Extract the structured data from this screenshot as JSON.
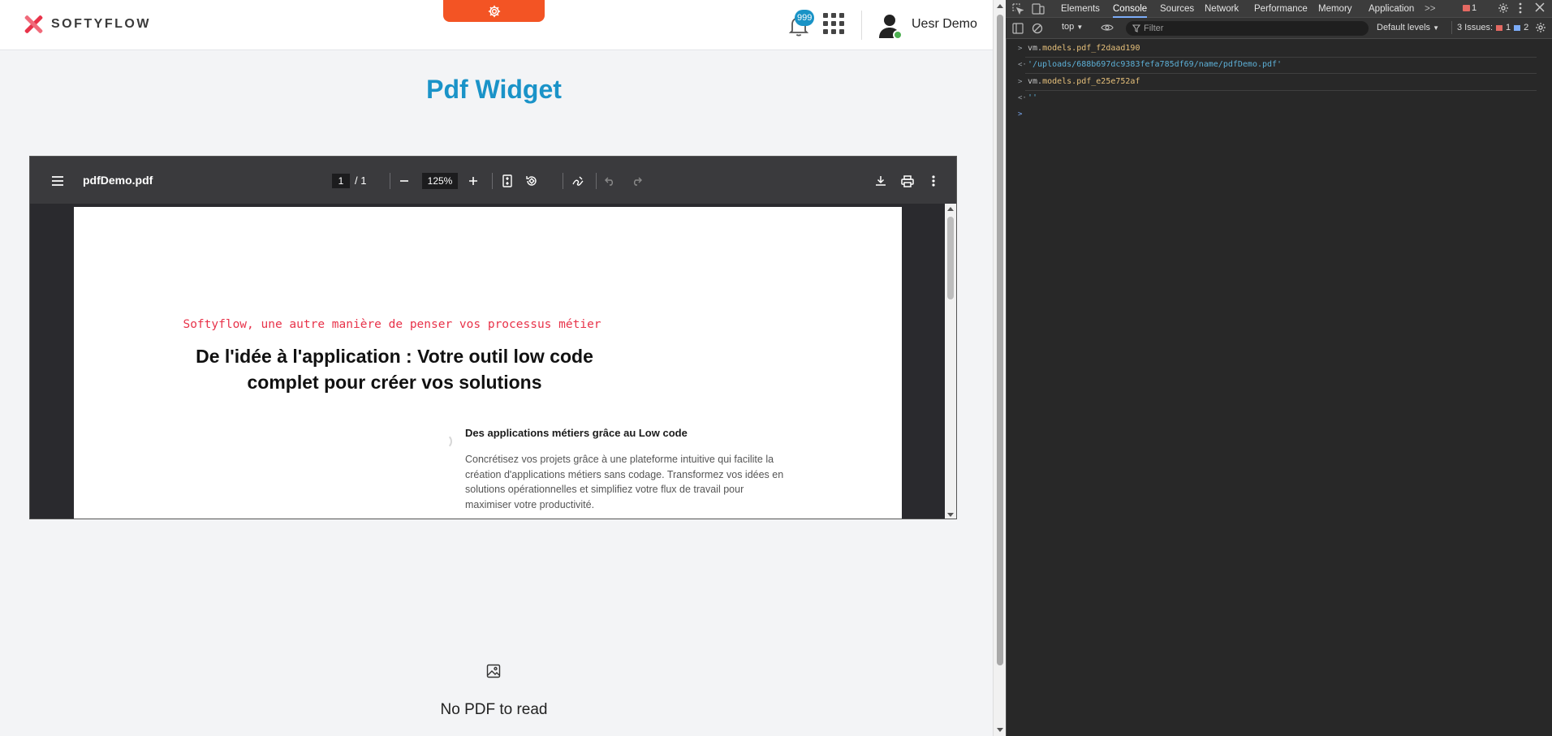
{
  "app": {
    "logo_text": "SOFTYFLOW",
    "notifications_count": "999",
    "user_name": "Uesr Demo",
    "page_title": "Pdf Widget"
  },
  "pdf_viewer": {
    "file_name": "pdfDemo.pdf",
    "current_page": "1",
    "page_total": "/ 1",
    "zoom": "125%",
    "document": {
      "tagline": "Softyflow, une autre manière de penser vos processus métier",
      "heading": "De l'idée à l'application : Votre outil low code complet pour créer vos solutions",
      "subheading": "Des applications métiers grâce au Low code",
      "paragraph": "Concrétisez vos projets grâce à une plateforme intuitive qui facilite la création d'applications métiers sans codage. Transformez vos idées en solutions opérationnelles et simplifiez votre flux de travail pour maximiser votre productivité."
    }
  },
  "empty_widget": {
    "message": "No PDF to read"
  },
  "devtools": {
    "tabs": [
      "Elements",
      "Console",
      "Sources",
      "Network",
      "Performance",
      "Memory",
      "Application"
    ],
    "active_tab": "Console",
    "error_count": "1",
    "context": "top",
    "filter_placeholder": "Filter",
    "levels": "Default levels",
    "issues_label": "3 Issues:",
    "issues_errors": "1",
    "issues_info": "2",
    "console": [
      {
        "type": "input",
        "obj": "vm.",
        "prop": "models.pdf_f2daad190"
      },
      {
        "type": "output",
        "value": "'/uploads/688b697dc9383fefa785df69/name/pdfDemo.pdf'"
      },
      {
        "type": "input",
        "obj": "vm.",
        "prop": "models.pdf_e25e752af"
      },
      {
        "type": "output",
        "value": "''"
      }
    ]
  },
  "colors": {
    "brand_red": "#e8334a",
    "accent_orange": "#f35424",
    "title_blue": "#1a93c8",
    "badge_blue": "#1993c6"
  }
}
